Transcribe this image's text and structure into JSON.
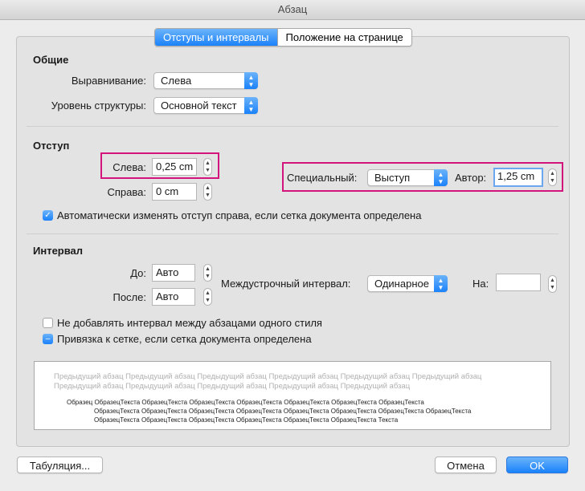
{
  "window": {
    "title": "Абзац"
  },
  "tabs": [
    {
      "label": "Отступы и интервалы",
      "active": true
    },
    {
      "label": "Положение на странице",
      "active": false
    }
  ],
  "general": {
    "title": "Общие",
    "alignment_label": "Выравнивание:",
    "alignment_value": "Слева",
    "outline_label": "Уровень структуры:",
    "outline_value": "Основной текст"
  },
  "indent": {
    "title": "Отступ",
    "left_label": "Слева:",
    "left_value": "0,25 cm",
    "right_label": "Справа:",
    "right_value": "0 cm",
    "special_label": "Специальный:",
    "special_value": "Выступ",
    "by_label": "Автор:",
    "by_value": "1,25 cm",
    "auto_adjust_label": "Автоматически изменять отступ справа, если сетка документа определена",
    "auto_adjust_checked": true
  },
  "spacing": {
    "title": "Интервал",
    "before_label": "До:",
    "before_value": "Авто",
    "after_label": "После:",
    "after_value": "Авто",
    "line_spacing_label": "Междустрочный интервал:",
    "line_spacing_value": "Одинарное",
    "at_label": "На:",
    "at_value": "",
    "dont_add_label": "Не добавлять интервал между абзацами одного стиля",
    "dont_add_checked": false,
    "snap_grid_label": "Привязка к сетке, если сетка документа определена",
    "snap_grid_state": "mixed"
  },
  "preview": {
    "previous_line1": "Предыдущий абзац Предыдущий абзац Предыдущий абзац Предыдущий абзац Предыдущий абзац Предыдущий абзац",
    "previous_line2": "Предыдущий абзац Предыдущий абзац Предыдущий абзац Предыдущий абзац Предыдущий абзац",
    "sample_line1": "Образец ОбразецТекста ОбразецТекста ОбразецТекста ОбразецТекста ОбразецТекста ОбразецТекста ОбразецТекста",
    "sample_line2": "ОбразецТекста ОбразецТекста ОбразецТекста ОбразецТекста ОбразецТекста ОбразецТекста ОбразецТекста ОбразецТекста",
    "sample_line3": "ОбразецТекста ОбразецТекста ОбразецТекста ОбразецТекста ОбразецТекста ОбразецТекста Текста"
  },
  "footer": {
    "tabs_button": "Табуляция...",
    "cancel_button": "Отмена",
    "ok_button": "OK"
  },
  "colors": {
    "accent": "#1a82fb",
    "highlight": "#d3147c"
  }
}
